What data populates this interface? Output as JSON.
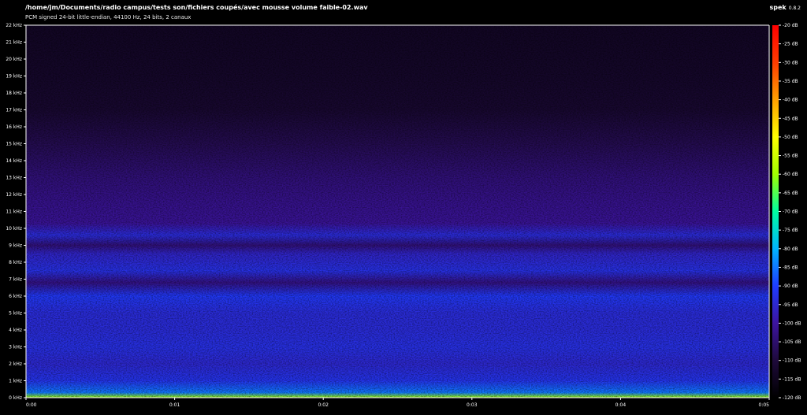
{
  "header": {
    "file_path": "/home/jm/Documents/radio campus/tests son/fichiers coupés/avec mousse volume faible-02.wav",
    "info": "PCM signed 24-bit little-endian, 44100 Hz, 24 bits, 2 canaux"
  },
  "app": {
    "name": "spek",
    "version": "0.8.2"
  },
  "chart_data": {
    "type": "heatmap",
    "title": "",
    "x": {
      "label": "",
      "range": [
        0,
        0.05
      ],
      "ticks": [
        0,
        0.01,
        0.02,
        0.03,
        0.04,
        0.05
      ],
      "tick_labels": [
        "0:00",
        "0:01",
        "0:02",
        "0:03",
        "0:04",
        "0:05"
      ]
    },
    "y": {
      "label": "",
      "range": [
        0,
        22
      ],
      "unit": "kHz",
      "tick_labels": [
        "0 kHz",
        "1 kHz",
        "2 kHz",
        "3 kHz",
        "4 kHz",
        "5 kHz",
        "6 kHz",
        "7 kHz",
        "8 kHz",
        "9 kHz",
        "10 kHz",
        "11 kHz",
        "12 kHz",
        "13 kHz",
        "14 kHz",
        "15 kHz",
        "16 kHz",
        "17 kHz",
        "18 kHz",
        "19 kHz",
        "20 kHz",
        "21 kHz",
        "22 kHz"
      ]
    },
    "colorbar": {
      "range_db": [
        -120,
        -20
      ],
      "tick_labels": [
        "-20 dB",
        "-25 dB",
        "-30 dB",
        "-35 dB",
        "-40 dB",
        "-45 dB",
        "-50 dB",
        "-55 dB",
        "-60 dB",
        "-65 dB",
        "-70 dB",
        "-75 dB",
        "-80 dB",
        "-85 dB",
        "-90 dB",
        "-95 dB",
        "-100 dB",
        "-105 dB",
        "-110 dB",
        "-115 dB",
        "-120 dB"
      ]
    },
    "intensity_profile": [
      {
        "khz": 0,
        "db": -60
      },
      {
        "khz": 0.3,
        "db": -85
      },
      {
        "khz": 1,
        "db": -92
      },
      {
        "khz": 2,
        "db": -95
      },
      {
        "khz": 3,
        "db": -93
      },
      {
        "khz": 4,
        "db": -94
      },
      {
        "khz": 5,
        "db": -94
      },
      {
        "khz": 6,
        "db": -91
      },
      {
        "khz": 6.8,
        "db": -103
      },
      {
        "khz": 7.5,
        "db": -93
      },
      {
        "khz": 8.5,
        "db": -96
      },
      {
        "khz": 9,
        "db": -104
      },
      {
        "khz": 9.6,
        "db": -94
      },
      {
        "khz": 10.3,
        "db": -101
      },
      {
        "khz": 11.5,
        "db": -102
      },
      {
        "khz": 13,
        "db": -104
      },
      {
        "khz": 15,
        "db": -108
      },
      {
        "khz": 17,
        "db": -112
      },
      {
        "khz": 19,
        "db": -113
      },
      {
        "khz": 22,
        "db": -114
      }
    ],
    "colors": {
      "scale": [
        "#000000",
        "#1e0a3c",
        "#3c14a0",
        "#1e3cff",
        "#00b4ff",
        "#00ffa0",
        "#a0ff00",
        "#ffff00",
        "#ffa000",
        "#ff3c00",
        "#ff0000"
      ]
    }
  }
}
